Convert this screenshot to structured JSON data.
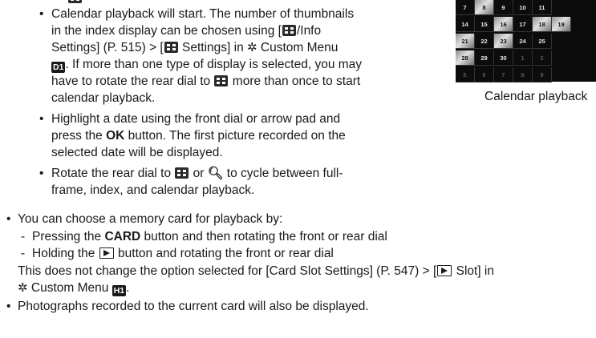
{
  "bullet": "•",
  "dash": "-",
  "gear_glyph": "✲",
  "magnifier_glyph": "🔍︎",
  "icon_labels": {
    "d1": "D1",
    "h1": "H1"
  },
  "calendar": {
    "caption": "Calendar playback",
    "rows": [
      [
        "7",
        "8",
        "9",
        "10",
        "11"
      ],
      [
        "14",
        "15",
        "16",
        "17",
        "18",
        "19"
      ],
      [
        "21",
        "22",
        "23",
        "24",
        "25"
      ],
      [
        "28",
        "29",
        "30",
        "1",
        "2"
      ],
      [
        "5",
        "6",
        "7",
        "8",
        "9"
      ]
    ],
    "photo_days": [
      "8",
      "16",
      "18",
      "19",
      "21",
      "23",
      "28"
    ]
  },
  "sub_bullets": {
    "b1": {
      "l1": "Calendar playback will start. The number of thumbnails",
      "l2_a": "in the index display can be chosen using [",
      "l2_b": "/Info",
      "l3_a": "Settings] (P. 515) > [",
      "l3_b": " Settings] in ",
      "l3_c": " Custom Menu",
      "l4_b": ". If more than one type of display is selected, you may",
      "l5_a": "have to rotate the rear dial to ",
      "l5_b": " more than once to start",
      "l6": "calendar playback."
    },
    "b2": {
      "l1": "Highlight a date using the front dial or arrow pad and",
      "l2_a": "press the ",
      "l2_ok": "OK",
      "l2_b": " button. The first picture recorded on the",
      "l3": "selected date will be displayed."
    },
    "b3": {
      "l1_a": "Rotate the rear dial to ",
      "l1_b": " or ",
      "l1_c": " to cycle between full-",
      "l2": "frame, index, and calendar playback."
    }
  },
  "main_bullets": {
    "m1": {
      "l1": "You can choose a memory card for playback by:",
      "d1_a": "Pressing the ",
      "d1_card": "CARD",
      "d1_b": " button and then rotating the front or rear dial",
      "d2_a": "Holding the ",
      "d2_b": " button and rotating the front or rear dial",
      "n1_a": "This does not change the option selected for [Card Slot Settings] (P. 547) > [",
      "n1_b": " Slot] in",
      "n2_b": " Custom Menu ",
      "n2_c": "."
    },
    "m2": "Photographs recorded to the current card will also be displayed."
  }
}
